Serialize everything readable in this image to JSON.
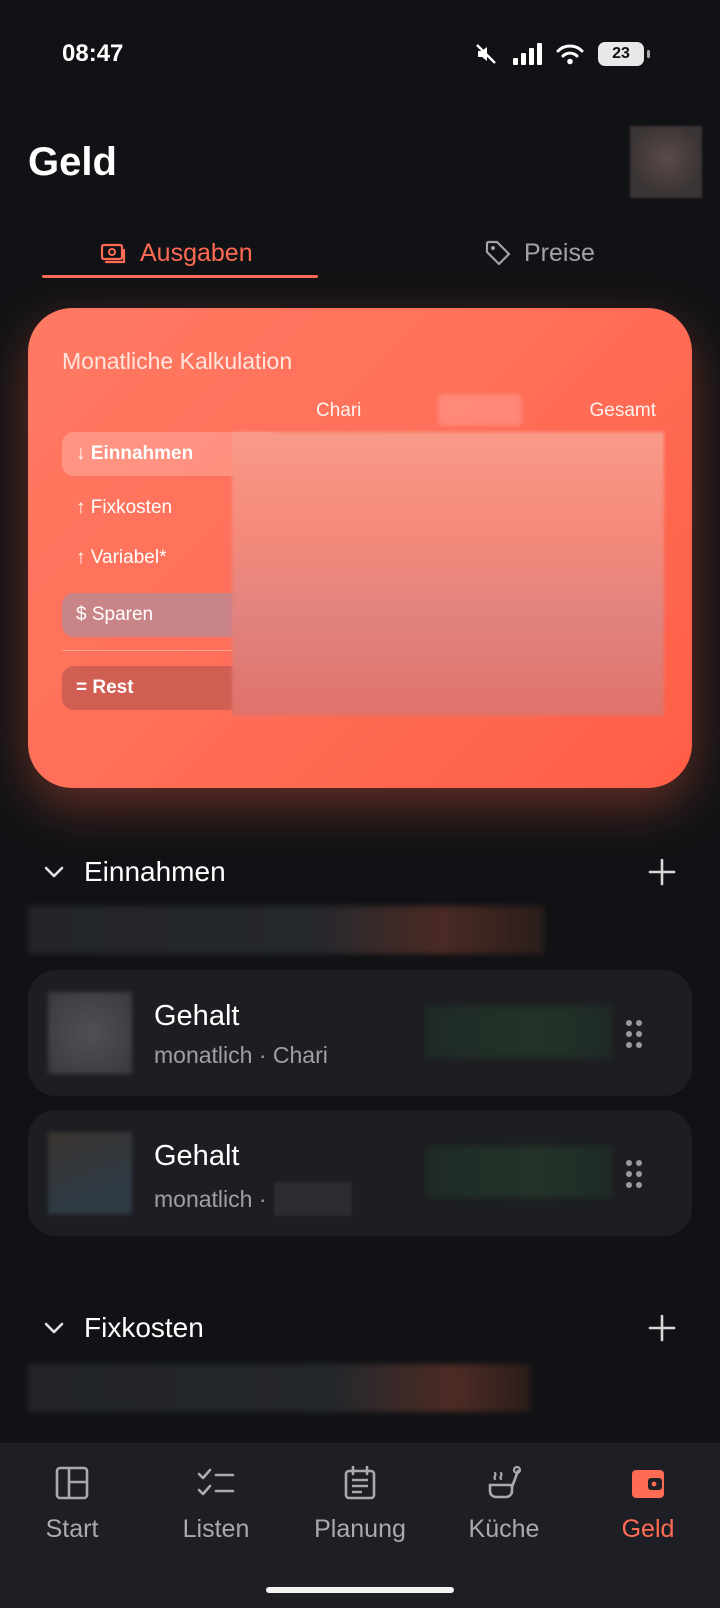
{
  "status_bar": {
    "time": "08:47",
    "battery": "23"
  },
  "header": {
    "title": "Geld"
  },
  "tabs": [
    {
      "label": "Ausgaben",
      "active": true
    },
    {
      "label": "Preise",
      "active": false
    }
  ],
  "calculation": {
    "title": "Monatliche Kalkulation",
    "columns": {
      "chari": "Chari",
      "gesamt": "Gesamt"
    },
    "rows": {
      "einnahmen": "↓ Einnahmen",
      "fixkosten": "↑ Fixkosten",
      "variabel": "↑ Variabel*",
      "sparen": "$ Sparen",
      "rest": "= Rest"
    }
  },
  "sections": {
    "einnahmen": {
      "title": "Einnahmen",
      "items": [
        {
          "title": "Gehalt",
          "subtitle": "monatlich · Chari"
        },
        {
          "title": "Gehalt",
          "subtitle": "monatlich ·"
        }
      ]
    },
    "fixkosten": {
      "title": "Fixkosten"
    }
  },
  "bottom_nav": [
    {
      "label": "Start",
      "icon": "layout-icon"
    },
    {
      "label": "Listen",
      "icon": "checklist-icon"
    },
    {
      "label": "Planung",
      "icon": "calendar-icon"
    },
    {
      "label": "Küche",
      "icon": "cooking-pot-icon"
    },
    {
      "label": "Geld",
      "icon": "wallet-icon",
      "active": true
    }
  ],
  "colors": {
    "accent": "#ff6b55",
    "background": "#111215",
    "card": "#1d1e22"
  }
}
